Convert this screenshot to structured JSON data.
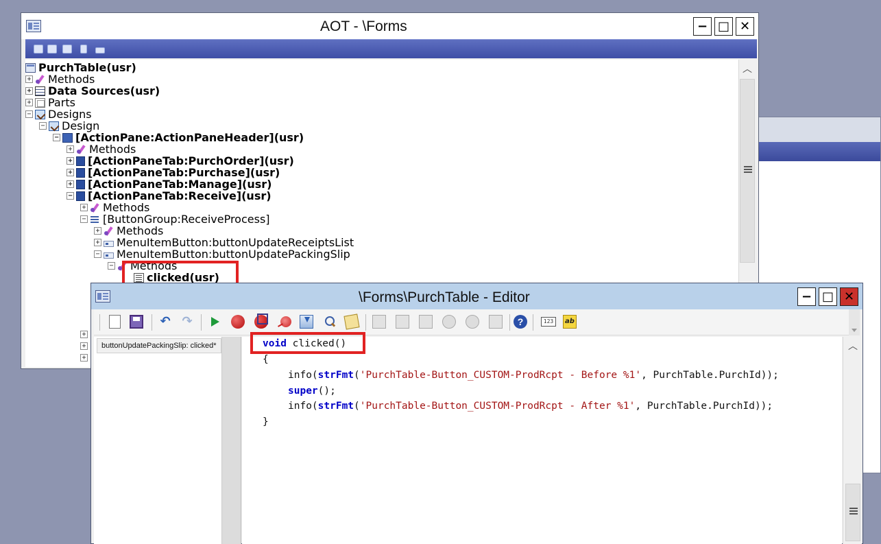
{
  "aot": {
    "title": "AOT - \\Forms",
    "tree": [
      {
        "label": "PurchTable(usr)"
      },
      {
        "label": "Methods"
      },
      {
        "label": "Data Sources(usr)"
      },
      {
        "label": "Parts"
      },
      {
        "label": "Designs"
      },
      {
        "label": "Design"
      },
      {
        "label": "[ActionPane:ActionPaneHeader](usr)"
      },
      {
        "label": "Methods"
      },
      {
        "label": "[ActionPaneTab:PurchOrder](usr)"
      },
      {
        "label": "[ActionPaneTab:Purchase](usr)"
      },
      {
        "label": "[ActionPaneTab:Manage](usr)"
      },
      {
        "label": "[ActionPaneTab:Receive](usr)"
      },
      {
        "label": "Methods"
      },
      {
        "label": "[ButtonGroup:ReceiveProcess]"
      },
      {
        "label": "Methods"
      },
      {
        "label": "MenuItemButton:buttonUpdateReceiptsList"
      },
      {
        "label": "MenuItemButton:buttonUpdatePackingSlip"
      },
      {
        "label": "Methods"
      },
      {
        "label": "clicked(usr)"
      }
    ]
  },
  "editor": {
    "title": "\\Forms\\PurchTable - Editor",
    "method_tab": "buttonUpdatePackingSlip: clicked*",
    "code": {
      "l1_kw": "void",
      "l1_rest": " clicked()",
      "l2": "{",
      "l3_a": "info(",
      "l3_fn": "strFmt",
      "l3_b": "(",
      "l3_str": "'PurchTable-Button_CUSTOM-ProdRcpt - Before %1'",
      "l3_c": ", PurchTable.PurchId));",
      "l4_kw": "super",
      "l4_rest": "();",
      "l5_a": "info(",
      "l5_fn": "strFmt",
      "l5_b": "(",
      "l5_str": "'PurchTable-Button_CUSTOM-ProdRcpt - After %1'",
      "l5_c": ", PurchTable.PurchId));",
      "l6": "}"
    },
    "toolbar_icons": [
      "new-icon",
      "save-icon",
      "undo-icon",
      "redo-icon",
      "run-icon",
      "breakpoint-icon",
      "toggle-breakpoint-icon",
      "remove-breakpoints-icon",
      "import-icon",
      "find-icon",
      "script-icon",
      "help-icon",
      "number-icon",
      "spellcheck-icon"
    ]
  },
  "window_buttons": {
    "minimize": "−",
    "maximize": "□",
    "close": "✕"
  },
  "colors": {
    "highlight": "#e12222",
    "keyword": "#0000c8",
    "string": "#a31515",
    "toolbar_blue": "#3e4ea6"
  }
}
